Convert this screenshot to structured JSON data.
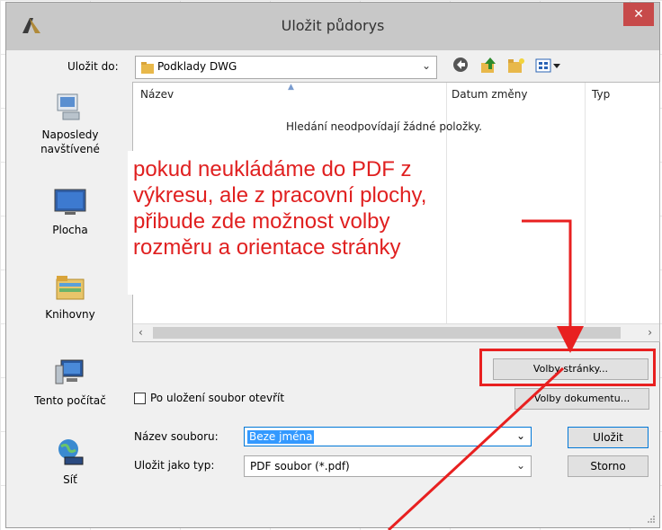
{
  "dialog": {
    "title": "Uložit půdorys",
    "close_glyph": "✕"
  },
  "location": {
    "label": "Uložit do:",
    "value": "Podklady DWG",
    "toolbar_icons": [
      "back-icon",
      "up-folder-icon",
      "new-folder-icon",
      "view-menu-icon"
    ]
  },
  "places": [
    {
      "label": "Naposledy navštívené",
      "icon": "recent-places-icon"
    },
    {
      "label": "Plocha",
      "icon": "desktop-icon"
    },
    {
      "label": "Knihovny",
      "icon": "libraries-icon"
    },
    {
      "label": "Tento počítač",
      "icon": "computer-icon"
    },
    {
      "label": "Síť",
      "icon": "network-icon"
    }
  ],
  "filelist": {
    "columns": [
      "Název",
      "Datum změny",
      "Typ"
    ],
    "empty_message": "Hledání neodpovídají žádné položky."
  },
  "buttons": {
    "page_options": "Volby stránky...",
    "document_options": "Volby dokumentu...",
    "save": "Uložit",
    "cancel": "Storno"
  },
  "open_after_save": {
    "label": "Po uložení soubor otevřít",
    "checked": false
  },
  "filename": {
    "label": "Název souboru:",
    "value": "Beze jména"
  },
  "filetype": {
    "label": "Uložit jako typ:",
    "value": "PDF soubor (*.pdf)"
  },
  "annotation": {
    "lines": [
      "pokud neukládáme do PDF z",
      "výkresu, ale z pracovní plochy,",
      "přibude zde možnost volby",
      "rozměru a orientace stránky"
    ],
    "color": "#e02020"
  },
  "colors": {
    "titlebar": "#c8c8c8",
    "close_button": "#c74a4a",
    "selection": "#3399ff",
    "folder": "#e8b84a"
  }
}
